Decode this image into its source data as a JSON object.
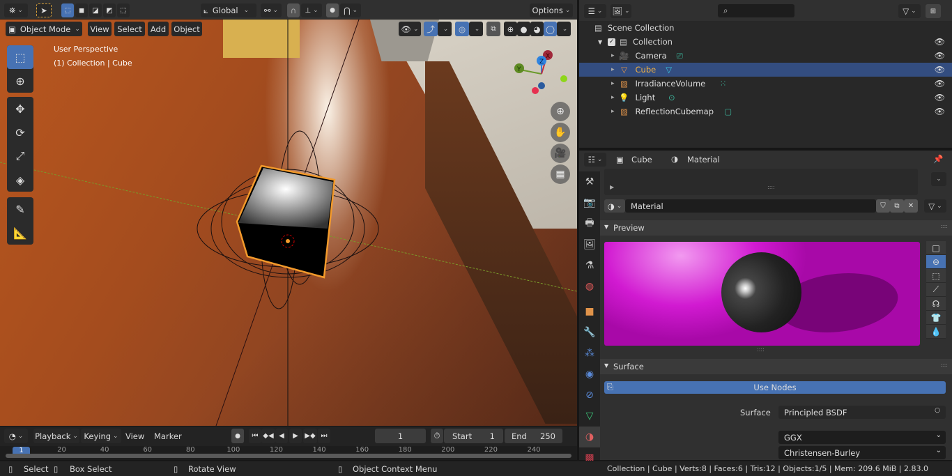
{
  "header": {
    "editor_type_icon": "3d-viewport-icon",
    "transform_orientation": "Global",
    "options_label": "Options"
  },
  "viewport_header": {
    "mode": "Object Mode",
    "menus": [
      "View",
      "Select",
      "Add",
      "Object"
    ]
  },
  "viewport": {
    "perspective_label": "User Perspective",
    "collection_label": "(1) Collection | Cube",
    "gizmo_axes": {
      "x": "X",
      "y": "Y",
      "z": "Z"
    },
    "tools": [
      "select-box",
      "cursor",
      "move",
      "rotate",
      "scale",
      "transform",
      "annotate",
      "measure"
    ],
    "nav_buttons": [
      "zoom",
      "pan",
      "camera",
      "perspective-toggle"
    ]
  },
  "outliner": {
    "search_placeholder": "",
    "scene_collection": "Scene Collection",
    "collection": "Collection",
    "items": [
      {
        "name": "Camera",
        "type": "camera",
        "selected": false
      },
      {
        "name": "Cube",
        "type": "mesh",
        "selected": true
      },
      {
        "name": "IrradianceVolume",
        "type": "light-probe-grid",
        "selected": false
      },
      {
        "name": "Light",
        "type": "light",
        "selected": false
      },
      {
        "name": "ReflectionCubemap",
        "type": "light-probe-cube",
        "selected": false
      }
    ]
  },
  "properties": {
    "breadcrumb_object": "Cube",
    "breadcrumb_material": "Material",
    "material_name": "Material",
    "preview_label": "Preview",
    "surface_panel_label": "Surface",
    "use_nodes_label": "Use Nodes",
    "surface_field_label": "Surface",
    "surface_value": "Principled BSDF",
    "distribution": "GGX",
    "subsurface_method": "Christensen-Burley",
    "preview_shapes": [
      "plane",
      "sphere",
      "cube",
      "hair",
      "monkey",
      "cloth",
      "fluid"
    ],
    "preview_active": "sphere",
    "tabs": [
      "tool",
      "render",
      "output",
      "view-layer",
      "scene",
      "world",
      "object",
      "modifiers",
      "particles",
      "physics",
      "constraints",
      "data",
      "material",
      "texture"
    ],
    "active_tab": "material"
  },
  "timeline": {
    "menus": [
      "Playback",
      "Keying",
      "View",
      "Marker"
    ],
    "current_frame": "1",
    "start_label": "Start",
    "start_value": "1",
    "end_label": "End",
    "end_value": "250",
    "ruler_marks": [
      "1",
      "20",
      "40",
      "60",
      "80",
      "100",
      "120",
      "140",
      "160",
      "180",
      "200",
      "220",
      "240"
    ]
  },
  "statusbar": {
    "hint_select": "Select",
    "hint_box_select": "Box Select",
    "hint_rotate": "Rotate View",
    "hint_context": "Object Context Menu",
    "stats": "Collection | Cube | Verts:8 | Faces:6 | Tris:12 | Objects:1/5 | Mem: 209.6 MiB | 2.83.0"
  }
}
